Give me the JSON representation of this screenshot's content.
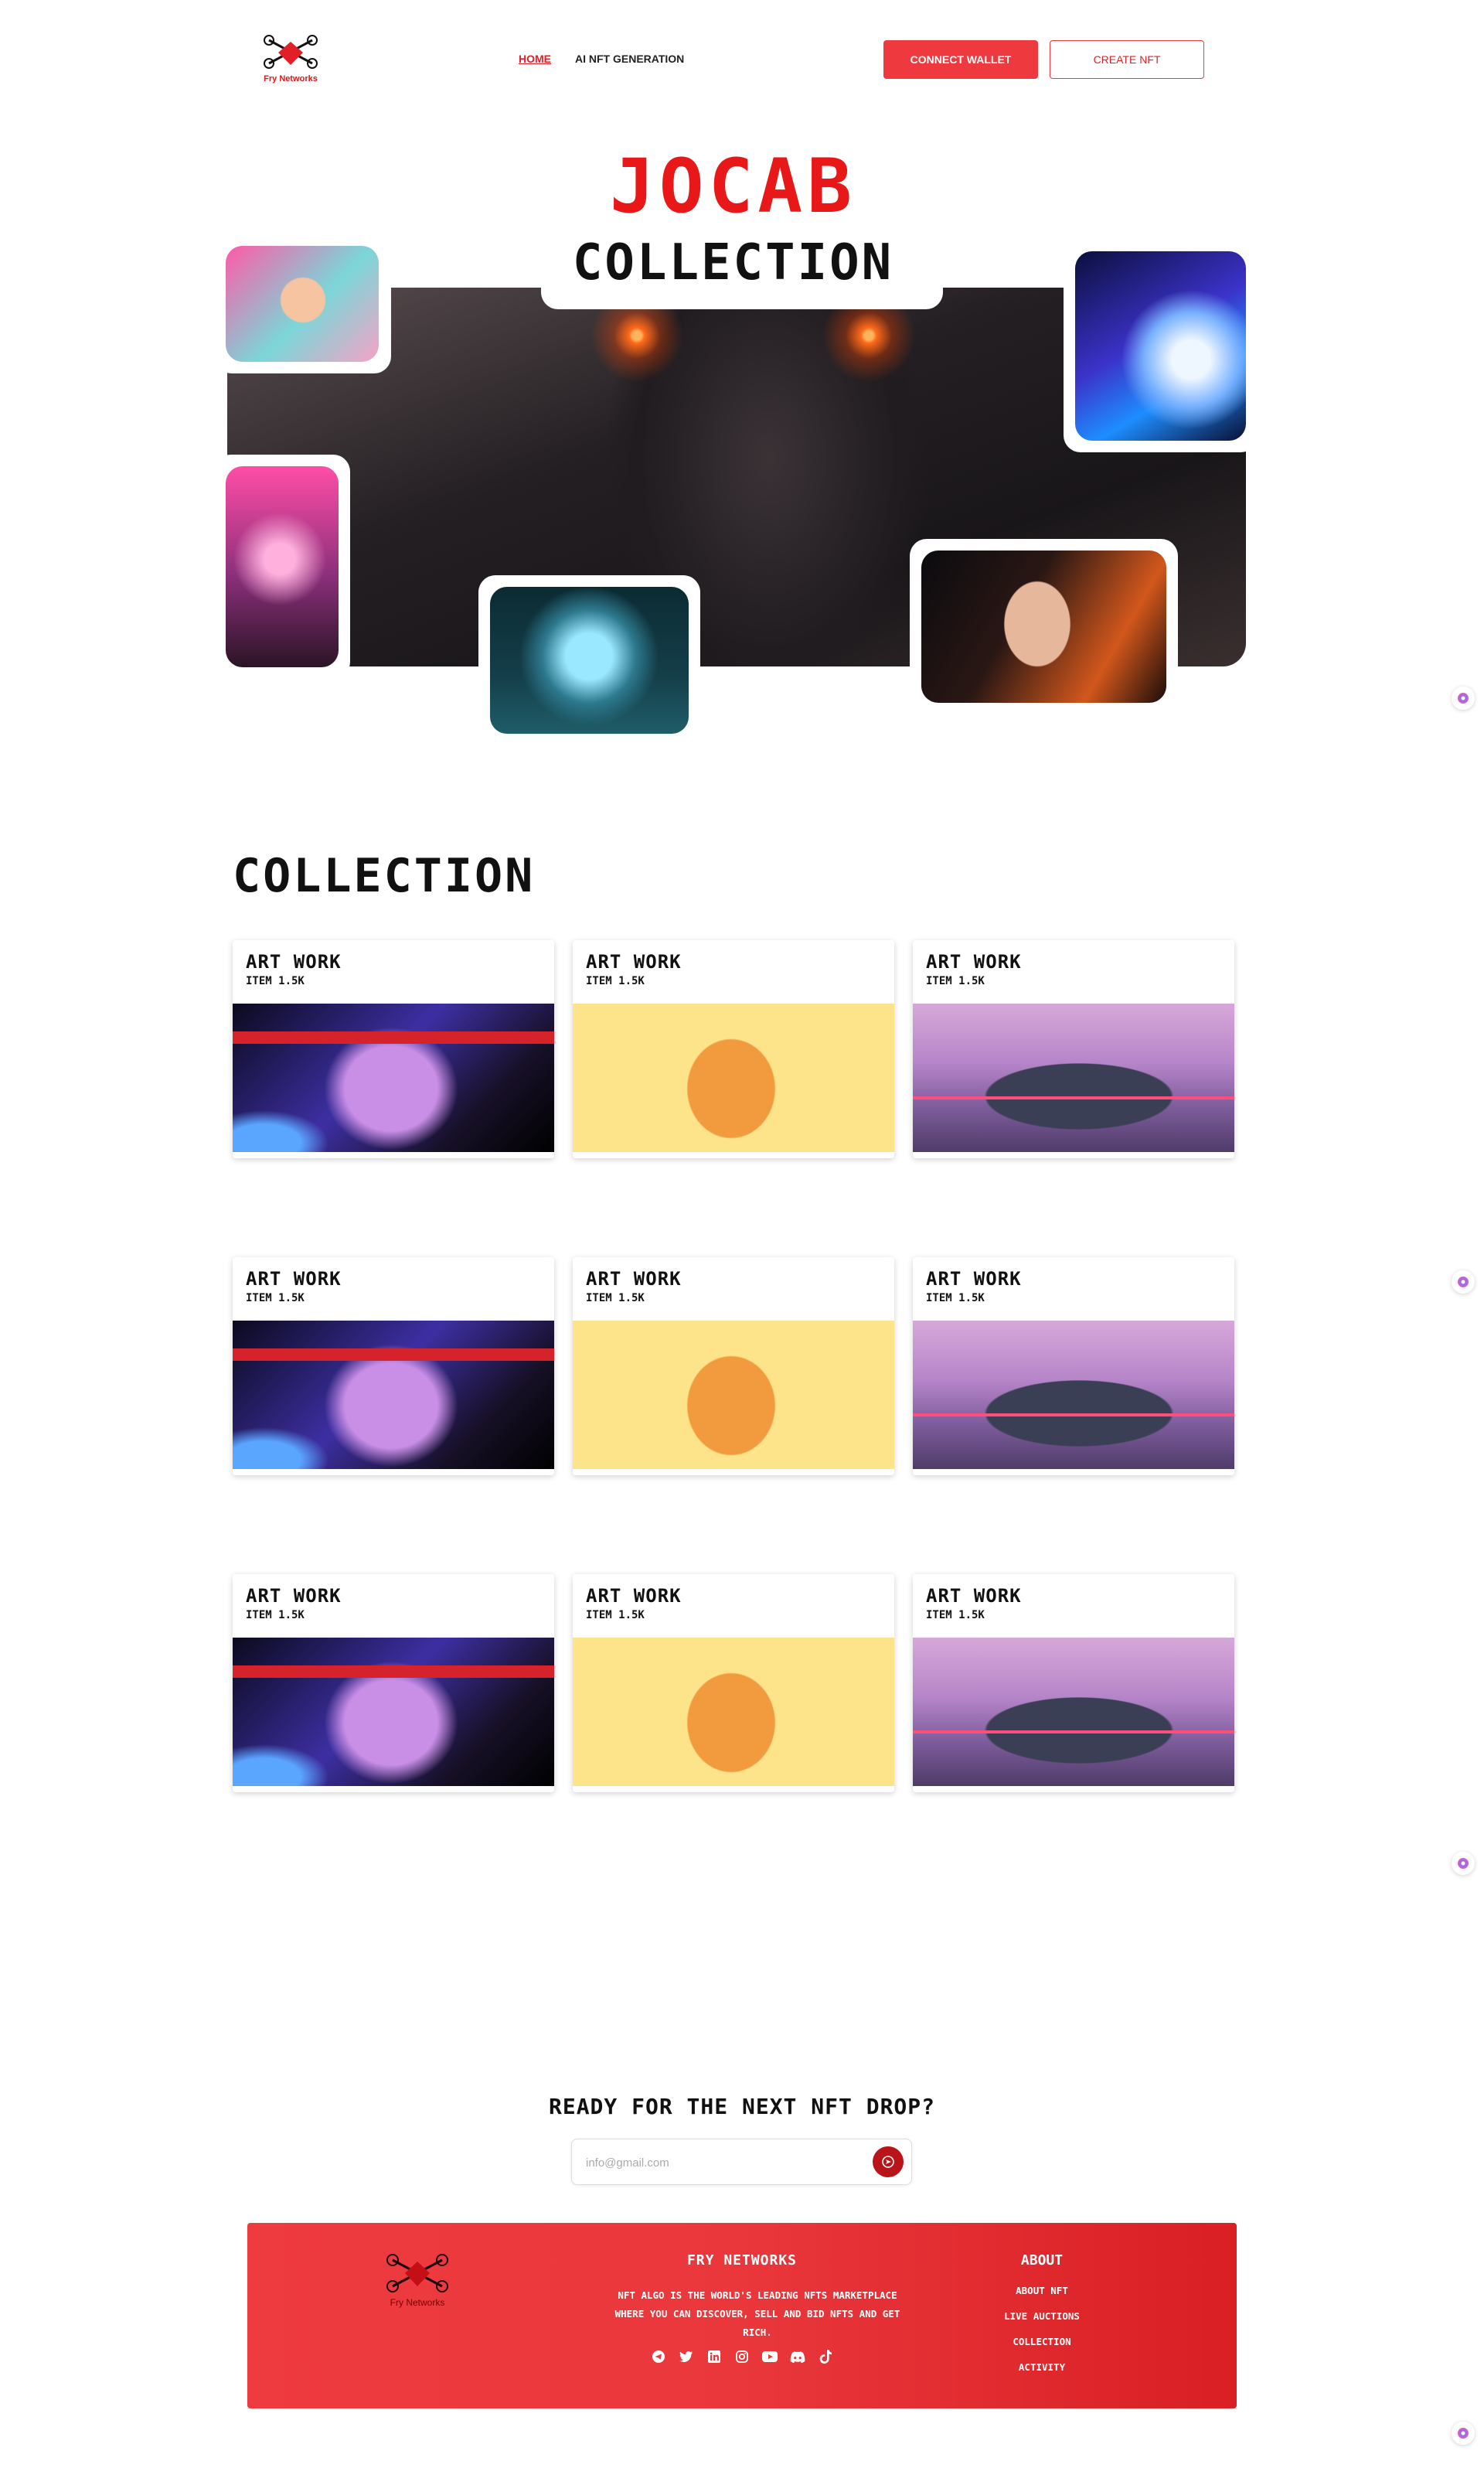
{
  "brand": {
    "logo_text": "Fry Networks",
    "accent": "#e01f26"
  },
  "nav": {
    "links": [
      {
        "label": "HOME",
        "active": true
      },
      {
        "label": "AI NFT GENERATION",
        "active": false
      }
    ],
    "connect_label": "CONNECT WALLET",
    "create_label": "CREATE NFT"
  },
  "hero": {
    "title": "JOCAB",
    "subtitle": "COLLECTION"
  },
  "collection": {
    "title": "COLLECTION",
    "cards": [
      {
        "title": "ART WORK",
        "sub": "ITEM 1.5K",
        "art": "statue"
      },
      {
        "title": "ART WORK",
        "sub": "ITEM 1.5K",
        "art": "cat"
      },
      {
        "title": "ART WORK",
        "sub": "ITEM 1.5K",
        "art": "car"
      },
      {
        "title": "ART WORK",
        "sub": "ITEM 1.5K",
        "art": "statue"
      },
      {
        "title": "ART WORK",
        "sub": "ITEM 1.5K",
        "art": "cat"
      },
      {
        "title": "ART WORK",
        "sub": "ITEM 1.5K",
        "art": "car"
      },
      {
        "title": "ART WORK",
        "sub": "ITEM 1.5K",
        "art": "statue"
      },
      {
        "title": "ART WORK",
        "sub": "ITEM 1.5K",
        "art": "cat"
      },
      {
        "title": "ART WORK",
        "sub": "ITEM 1.5K",
        "art": "car"
      }
    ]
  },
  "newsletter": {
    "title": "READY FOR THE NEXT NFT DROP?",
    "placeholder": "info@gmail.com"
  },
  "footer": {
    "logo_text": "Fry Networks",
    "brand": "FRY NETWORKS",
    "description": "NFT ALGO IS THE WORLD'S LEADING NFTS MARKETPLACE WHERE YOU CAN DISCOVER, SELL AND BID NFTS AND GET RICH.",
    "social_icons": [
      "telegram-icon",
      "twitter-icon",
      "linkedin-icon",
      "instagram-icon",
      "youtube-icon",
      "discord-icon",
      "tiktok-icon"
    ],
    "about": {
      "title": "ABOUT",
      "items": [
        "ABOUT NFT",
        "LIVE AUCTIONS",
        "COLLECTION",
        "ACTIVITY"
      ]
    }
  }
}
